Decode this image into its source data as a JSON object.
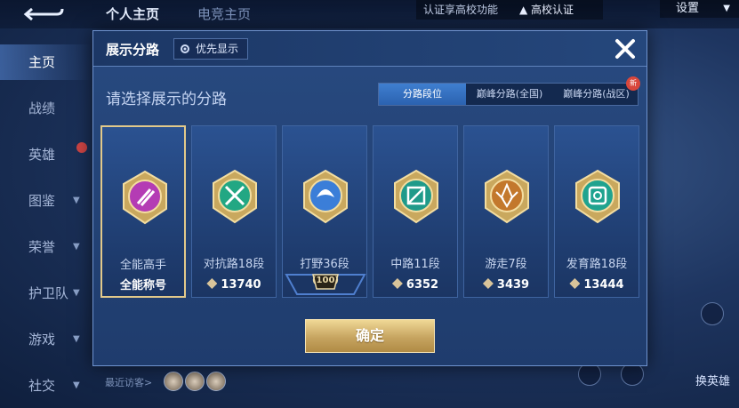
{
  "top_bar": {
    "tabs": [
      "个人主页",
      "电竞主页"
    ],
    "cert_text": "认证享高校功能",
    "cert_badge": "高校认证",
    "settings_label": "设置"
  },
  "side_nav": {
    "items": [
      {
        "label": "主页",
        "active": true
      },
      {
        "label": "战绩"
      },
      {
        "label": "英雄"
      },
      {
        "label": "图鉴"
      },
      {
        "label": "荣誉"
      },
      {
        "label": "护卫队"
      },
      {
        "label": "游戏"
      },
      {
        "label": "社交"
      }
    ]
  },
  "footer": {
    "recent_visitors": "最近访客>",
    "swap_hero": "换英雄"
  },
  "modal": {
    "title": "展示分路",
    "priority_label": "优先显示",
    "prompt": "请选择展示的分路",
    "tabs": [
      "分路段位",
      "巅峰分路(全国)",
      "巅峰分路(战区)"
    ],
    "new_badge": "新",
    "confirm_label": "确定",
    "cards": [
      {
        "name": "全能高手",
        "subtitle": "全能称号",
        "color": "#b43cb4"
      },
      {
        "name": "对抗路18段",
        "score": "13740",
        "color": "#22a783"
      },
      {
        "name": "打野36段",
        "level": "100",
        "color": "#3b7ed8"
      },
      {
        "name": "中路11段",
        "score": "6352",
        "color": "#1f9a8a"
      },
      {
        "name": "游走7段",
        "score": "3439",
        "color": "#c3782c"
      },
      {
        "name": "发育路18段",
        "score": "13444",
        "color": "#1fa38f"
      }
    ]
  },
  "colors": {
    "accent_gold": "#e2c98a",
    "tab_active": "#2f6cc0"
  }
}
